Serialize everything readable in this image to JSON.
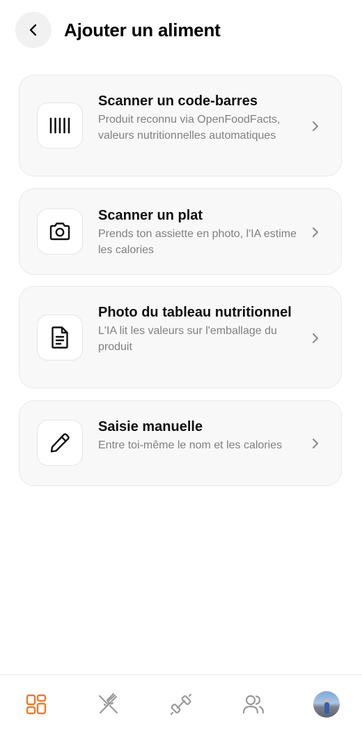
{
  "header": {
    "title": "Ajouter un aliment",
    "back_icon": "chevron-left-icon"
  },
  "options": [
    {
      "icon": "barcode-icon",
      "title": "Scanner un code-barres",
      "description": "Produit reconnu via OpenFoodFacts, valeurs nutritionnelles automatiques"
    },
    {
      "icon": "camera-icon",
      "title": "Scanner un plat",
      "description": "Prends ton assiette en photo, l'IA estime les calories"
    },
    {
      "icon": "document-icon",
      "title": "Photo du tableau nutritionnel",
      "description": "L'IA lit les valeurs sur l'emballage du produit"
    },
    {
      "icon": "pencil-icon",
      "title": "Saisie manuelle",
      "description": "Entre toi-même le nom et les calories"
    }
  ],
  "tabbar": {
    "active_color": "#f07a2a",
    "inactive_color": "#9a9a9a",
    "items": [
      {
        "icon": "dashboard-grid-icon",
        "active": true
      },
      {
        "icon": "fork-knife-icon",
        "active": false
      },
      {
        "icon": "dumbbell-icon",
        "active": false
      },
      {
        "icon": "users-icon",
        "active": false
      },
      {
        "icon": "profile-avatar",
        "active": false
      }
    ]
  }
}
